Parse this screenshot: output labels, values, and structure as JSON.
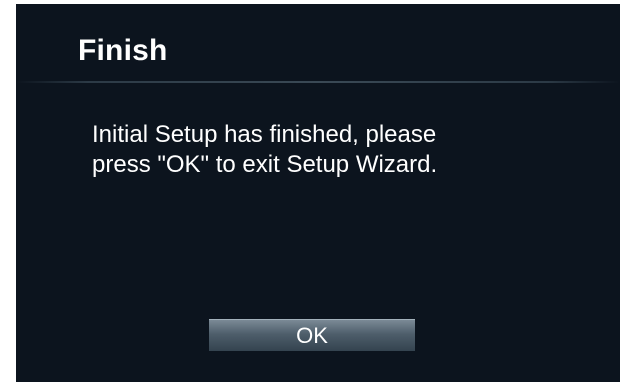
{
  "dialog": {
    "title": "Finish",
    "message_line1": "Initial Setup has finished, please",
    "message_line2": "press \"OK\" to exit Setup Wizard.",
    "ok_label": "OK"
  },
  "colors": {
    "background": "#0c141e",
    "text": "#ffffff",
    "button_top": "#7b8a96",
    "button_bottom": "#34434f"
  }
}
